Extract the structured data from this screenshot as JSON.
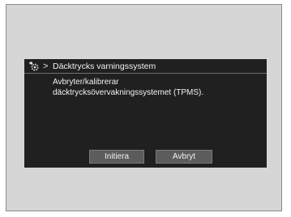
{
  "dialog": {
    "breadcrumb_icon": "settings-gear-icon",
    "breadcrumb_separator": ">",
    "title": "Däcktrycks varningssystem",
    "message_line1": "Avbryter/kalibrerar",
    "message_line2": "däcktrycksövervakningssystemet (TPMS).",
    "buttons": {
      "initiate_label": "Initiera",
      "cancel_label": "Avbryt"
    },
    "colors": {
      "screen_bg": "#202020",
      "button_bg": "#5c5c5c",
      "text": "#f2f2f2",
      "frame_bg": "#d6d6d6"
    }
  }
}
